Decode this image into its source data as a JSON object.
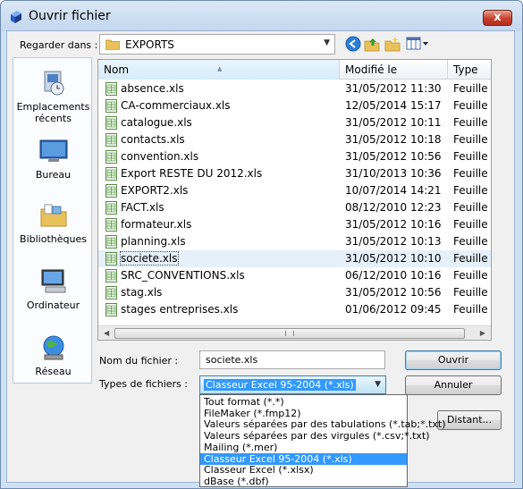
{
  "window": {
    "title": "Ouvrir fichier",
    "close_label": "x"
  },
  "lookin": {
    "label": "Regarder dans :",
    "folder": "EXPORTS"
  },
  "places": [
    {
      "label": "Emplacements récents"
    },
    {
      "label": "Bureau"
    },
    {
      "label": "Bibliothèques"
    },
    {
      "label": "Ordinateur"
    },
    {
      "label": "Réseau"
    }
  ],
  "columns": {
    "name": "Nom",
    "modified": "Modifié le",
    "type": "Type"
  },
  "files": [
    {
      "name": "absence.xls",
      "date": "31/05/2012 11:30",
      "type": "Feuille d"
    },
    {
      "name": "CA-commerciaux.xls",
      "date": "12/05/2014 15:17",
      "type": "Feuille d"
    },
    {
      "name": "catalogue.xls",
      "date": "31/05/2012 10:11",
      "type": "Feuille d"
    },
    {
      "name": "contacts.xls",
      "date": "31/05/2012 10:18",
      "type": "Feuille d"
    },
    {
      "name": "convention.xls",
      "date": "31/05/2012 10:56",
      "type": "Feuille d"
    },
    {
      "name": "Export RESTE DU 2012.xls",
      "date": "31/10/2013 10:36",
      "type": "Feuille d"
    },
    {
      "name": "EXPORT2.xls",
      "date": "10/07/2014 14:21",
      "type": "Feuille d"
    },
    {
      "name": "FACT.xls",
      "date": "08/12/2010 12:23",
      "type": "Feuille d"
    },
    {
      "name": "formateur.xls",
      "date": "31/05/2012 10:16",
      "type": "Feuille d"
    },
    {
      "name": "planning.xls",
      "date": "31/05/2012 10:13",
      "type": "Feuille d"
    },
    {
      "name": "societe.xls",
      "date": "31/05/2012 10:10",
      "type": "Feuille d"
    },
    {
      "name": "SRC_CONVENTIONS.xls",
      "date": "06/12/2010 10:16",
      "type": "Feuille d"
    },
    {
      "name": "stag.xls",
      "date": "31/05/2012 10:56",
      "type": "Feuille d"
    },
    {
      "name": "stages entreprises.xls",
      "date": "01/06/2012 09:45",
      "type": "Feuille d"
    },
    {
      "name": "",
      "date": "",
      "type": ""
    }
  ],
  "hot_index": 10,
  "filename": {
    "label": "Nom du fichier :",
    "value": "societe.xls"
  },
  "filetype": {
    "label": "Types de fichiers :",
    "value": "Classeur Excel 95-2004 (*.xls)",
    "options": [
      "Tout format (*.*)",
      "FileMaker (*.fmp12)",
      "Valeurs séparées par des tabulations (*.tab;*.txt)",
      "Valeurs séparées par des virgules (*.csv;*.txt)",
      "Mailing (*.mer)",
      "Classeur Excel 95-2004 (*.xls)",
      "Classeur Excel (*.xlsx)",
      "dBase (*.dbf)"
    ],
    "selected_index": 5
  },
  "buttons": {
    "open": "Ouvrir",
    "cancel": "Annuler",
    "remote": "Distant..."
  }
}
